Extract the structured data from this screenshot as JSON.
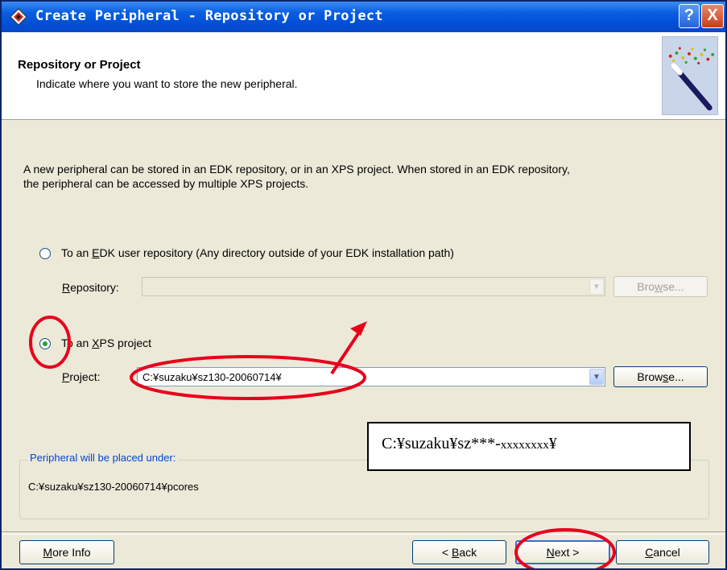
{
  "window": {
    "title": "Create Peripheral - Repository or Project",
    "help_label": "?",
    "close_label": "X"
  },
  "header": {
    "title": "Repository or Project",
    "subtitle": "Indicate where you want to store the new peripheral."
  },
  "description": {
    "line1": "A new peripheral can be stored in an EDK repository, or in an XPS project. When stored in an EDK repository,",
    "line2": "the peripheral can be accessed by multiple XPS projects."
  },
  "option_repo": {
    "pre": "To an ",
    "mnemonic": "E",
    "post": "DK user repository (Any directory outside of your EDK installation path)",
    "selected": false,
    "field_label_mn": "R",
    "field_label_rest": "epository:",
    "value": "",
    "browse_pre": "Bro",
    "browse_mn": "w",
    "browse_post": "se..."
  },
  "option_xps": {
    "pre": "To an ",
    "mnemonic": "X",
    "post": "PS project",
    "selected": true,
    "field_label_mn": "P",
    "field_label_rest": "roject:",
    "value": "C:¥suzaku¥sz130-20060714¥",
    "browse_pre": "Brow",
    "browse_mn": "s",
    "browse_post": "e..."
  },
  "placement": {
    "legend": "Peripheral will be placed under:",
    "value": "C:¥suzaku¥sz130-20060714¥pcores"
  },
  "buttons": {
    "more_info_mn": "M",
    "more_info_rest": "ore Info",
    "back_pre": "< ",
    "back_mn": "B",
    "back_rest": "ack",
    "next_mn": "N",
    "next_rest": "ext >",
    "cancel_mn": "C",
    "cancel_rest": "ancel"
  },
  "annotation": {
    "main": "C:¥suzaku¥sz***-",
    "small": "xxxxxxxx",
    "suffix": "¥",
    "color": "#e8001c"
  }
}
